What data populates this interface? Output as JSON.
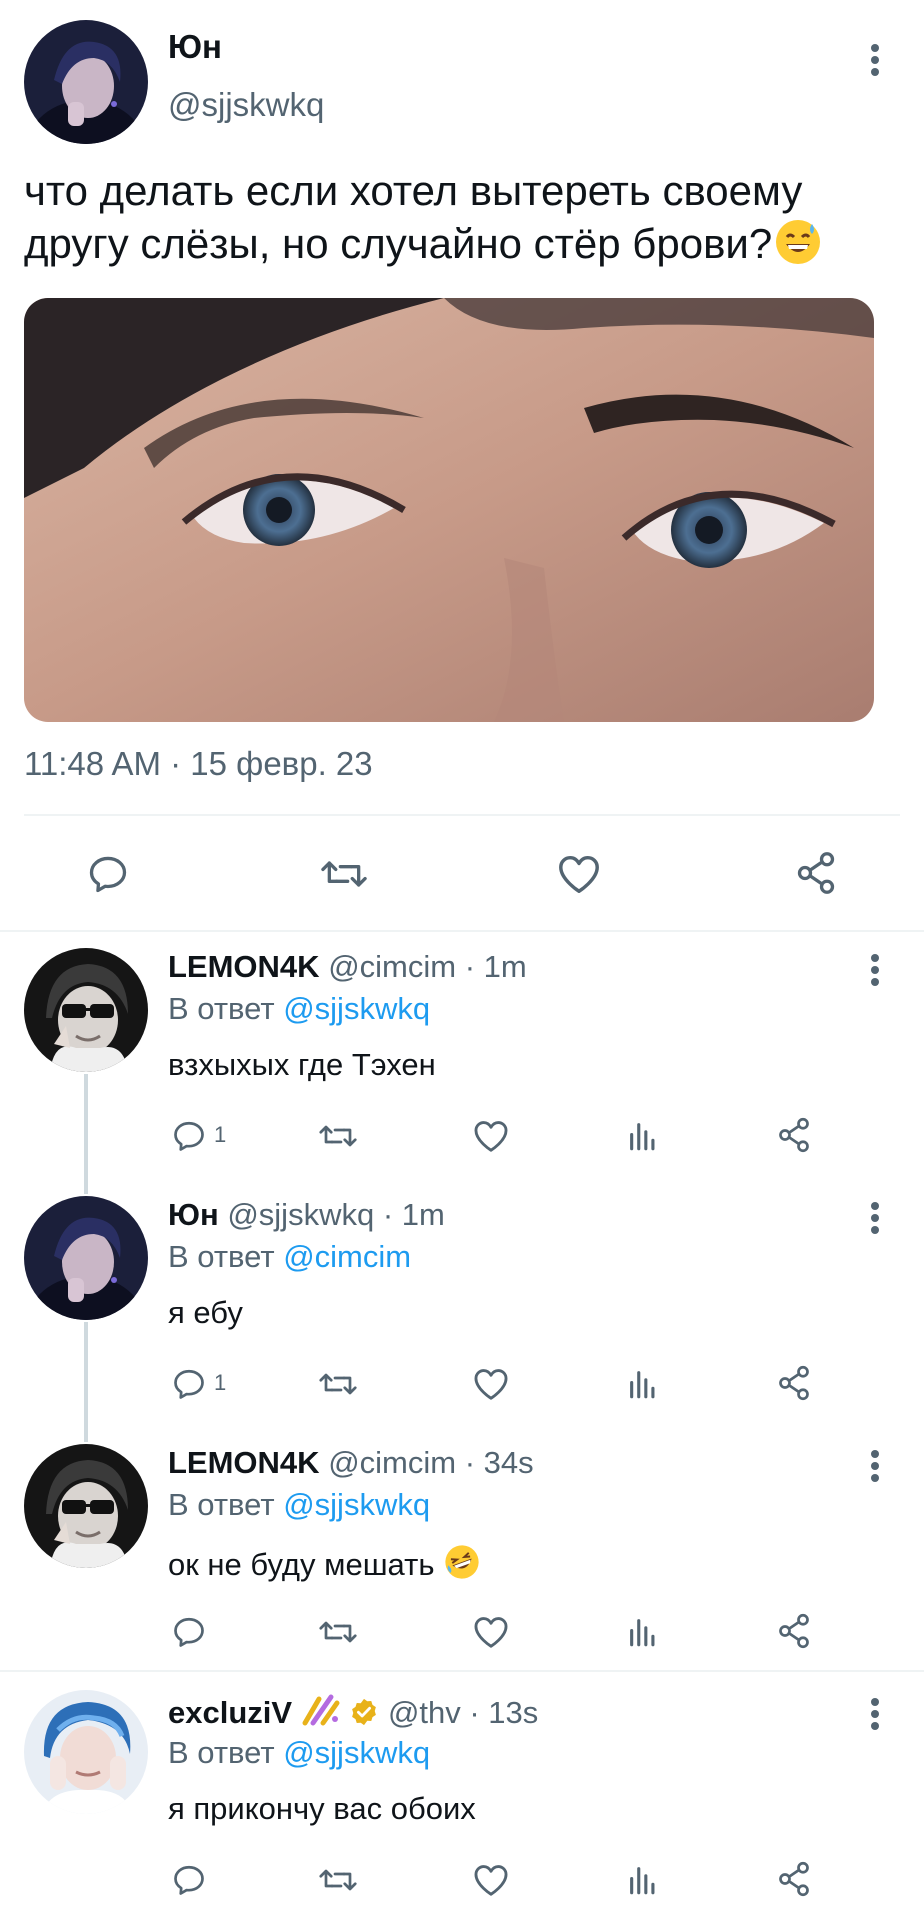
{
  "main_tweet": {
    "name": "Юн",
    "handle": "@sjjskwkq",
    "text": "что делать если хотел вытереть своему другу слёзы,  но случайно стёр брови?",
    "timestamp": "11:48 AM · 15 февр. 23",
    "actions": [
      "reply-icon",
      "retweet-icon",
      "like-icon",
      "share-icon"
    ]
  },
  "replies": [
    {
      "name": "LEMON4K",
      "meta": "@cimcim · 1m",
      "reply_prefix": "В ответ",
      "reply_to": "@sjjskwkq",
      "text": "взхыхых где Тэхен",
      "reply_count": "1"
    },
    {
      "name": "Юн",
      "meta": "@sjjskwkq · 1m",
      "reply_prefix": "В ответ",
      "reply_to": "@cimcim",
      "text": "я ебу",
      "reply_count": "1"
    },
    {
      "name": "LEMON4K",
      "meta": "@cimcim · 34s",
      "reply_prefix": "В ответ",
      "reply_to": "@sjjskwkq",
      "text": "ок не буду мешать",
      "reply_count": ""
    },
    {
      "name": "excluziV",
      "meta": "@thv · 13s",
      "reply_prefix": "В ответ",
      "reply_to": "@sjjskwkq",
      "text": "я прикончу вас обоих",
      "reply_count": ""
    }
  ],
  "colors": {
    "text": "#0f1419",
    "secondary": "#536471",
    "link": "#1d9bf0",
    "divider": "#eff3f4",
    "thread_line": "#cfd9de",
    "verified": "#e8b21a"
  }
}
